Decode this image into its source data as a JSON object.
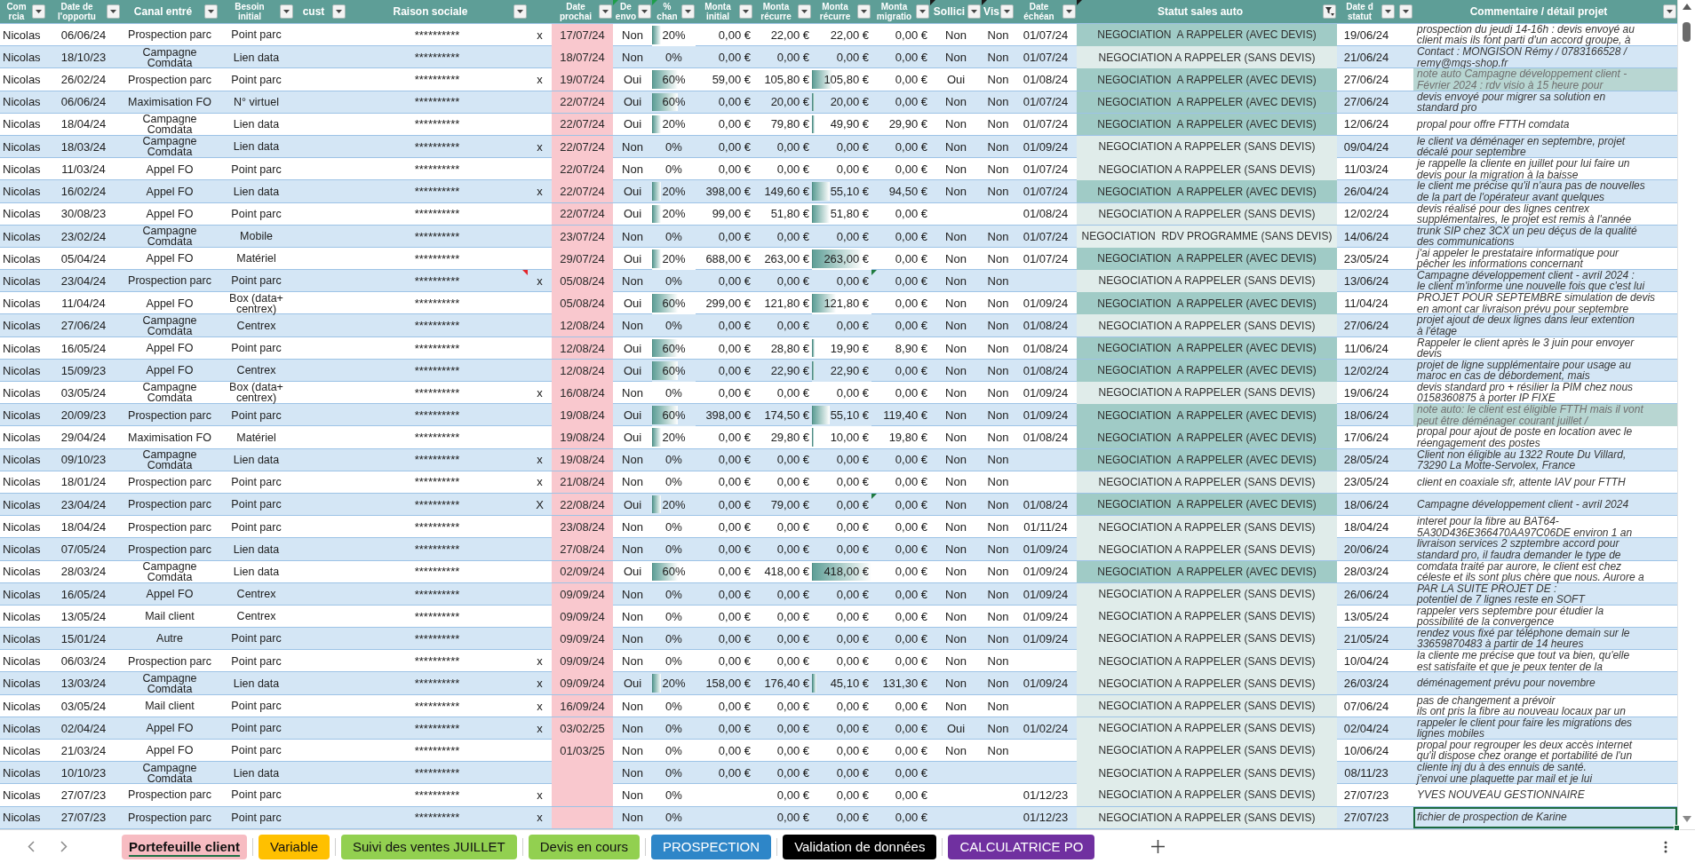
{
  "columns": [
    {
      "label": "Com\nrcia",
      "filter_active": false
    },
    {
      "label": "Date de\nl'opportu",
      "filter_active": false
    },
    {
      "label": "Canal entré",
      "filter_active": false
    },
    {
      "label": "Besoin\ninitial",
      "filter_active": false
    },
    {
      "label": "cust",
      "filter_active": false
    },
    {
      "label": "Raison sociale",
      "filter_active": false
    },
    {},
    {
      "label": "Date\nprochai",
      "filter_active": false
    },
    {
      "label": "De\nenvo",
      "filter_active": false,
      "corner_mark": {
        "color": "#1e9e4a",
        "kind": "error"
      }
    },
    {
      "label": "%\nchan",
      "filter_active": false,
      "corner_mark": {
        "color": "#1e9e4a",
        "kind": "error"
      }
    },
    {
      "label": "Monta\ninitial",
      "filter_active": false
    },
    {
      "label": "Monta\nrécurre",
      "filter_active": false
    },
    {
      "label": "Monta\nrécurre",
      "filter_active": false
    },
    {
      "label": "Monta\nmigratio",
      "filter_active": false
    },
    {
      "label": "Sollici",
      "filter_active": false,
      "corner_mark": {
        "color": "#1a1a1a",
        "kind": "error"
      }
    },
    {
      "label": "Vis",
      "filter_active": false,
      "corner_mark": {
        "color": "#1a1a1a",
        "kind": "error"
      }
    },
    {
      "label": "Date\néchéan",
      "filter_active": false
    },
    {
      "label": "Statut sales auto",
      "filter_active": true,
      "corner_mark": {
        "color": "#1a1a1a",
        "kind": "error"
      }
    },
    {
      "label": "Date d\nstatut",
      "filter_active": false
    },
    {
      "filter_active": false
    },
    {
      "label": "Commentaire / détail projet",
      "filter_active": false
    }
  ],
  "rows": [
    {
      "commercial": "Nicolas",
      "date_opportunite": "06/06/24",
      "canal": "Prospection parc",
      "besoin": "Point parc",
      "raison_sociale": "**********",
      "column_7": "x",
      "date_prochain": "17/07/24",
      "devis_envoye": "Non",
      "chance": {
        "text": "20%",
        "level": 0.2
      },
      "montant_initial": "0,00 €",
      "montant_recurrent": "22,00 €",
      "montant_recurrent_2": "22,00 €",
      "montant_migration": "0,00 €",
      "sollicit": "Non",
      "visi": "Non",
      "date_echeance": "01/07/24",
      "statut": {
        "text": "NEGOCIATION  A RAPPELER (AVEC DEVIS)",
        "color": "#a0cbc6"
      },
      "date_statut": "19/06/24",
      "commentaire": {
        "text": "prospection du jeudi 14-16h : devis envoyé au\nclient mais ils font parti d'un accord groupe, à",
        "highlighted": false,
        "selected": false
      }
    },
    {
      "commercial": "Nicolas",
      "date_opportunite": "18/10/23",
      "canal": "Campagne Comdata",
      "besoin": "Lien data",
      "raison_sociale": "**********",
      "date_prochain": "18/07/24",
      "devis_envoye": "Non",
      "chance": "0%",
      "montant_initial": "0,00 €",
      "montant_recurrent": "0,00 €",
      "montant_recurrent_2": "0,00 €",
      "montant_migration": "0,00 €",
      "sollicit": "Non",
      "visi": "Non",
      "date_echeance": "01/07/24",
      "statut": {
        "text": "NEGOCIATION A RAPPELER (SANS DEVIS)",
        "color": "#e0ecea"
      },
      "date_statut": "21/06/24",
      "commentaire": {
        "text": "Contact : MONGISON Rémy / 0783166528 /\nremy@mgs-shop.fr",
        "highlighted": false,
        "selected": false
      }
    },
    {
      "commercial": "Nicolas",
      "date_opportunite": "26/02/24",
      "canal": "Prospection parc",
      "besoin": "Point parc",
      "raison_sociale": "**********",
      "column_7": "x",
      "date_prochain": "19/07/24",
      "devis_envoye": "Oui",
      "chance": {
        "text": "60%",
        "level": 0.6
      },
      "montant_initial": "59,00 €",
      "montant_recurrent": "105,80 €",
      "montant_recurrent_2": {
        "text": "105,80 €",
        "level": 0.35
      },
      "montant_migration": "0,00 €",
      "sollicit": "Oui",
      "visi": "Non",
      "date_echeance": "01/08/24",
      "statut": {
        "text": "NEGOCIATION  A RAPPELER (AVEC DEVIS)",
        "color": "#a0cbc6"
      },
      "date_statut": "27/06/24",
      "commentaire": {
        "text": "note auto Campagne développement client -\nFévrier 2024 : rdv visio à 15 heure pour",
        "highlighted": true,
        "selected": false
      }
    },
    {
      "commercial": "Nicolas",
      "date_opportunite": "06/06/24",
      "canal": "Maximisation FO",
      "besoin": "N° virtuel",
      "raison_sociale": "**********",
      "date_prochain": "22/07/24",
      "devis_envoye": "Oui",
      "chance": {
        "text": "60%",
        "level": 0.6
      },
      "montant_initial": "0,00 €",
      "montant_recurrent": "20,00 €",
      "montant_recurrent_2": {
        "text": "20,00 €",
        "level": 0.05
      },
      "montant_migration": "0,00 €",
      "sollicit": "Non",
      "visi": "Non",
      "date_echeance": "01/07/24",
      "statut": {
        "text": "NEGOCIATION  A RAPPELER (AVEC DEVIS)",
        "color": "#a0cbc6"
      },
      "date_statut": "27/06/24",
      "commentaire": {
        "text": "devis envoyé pour migrer sa solution en\nstandard pro",
        "highlighted": false,
        "selected": false
      }
    },
    {
      "commercial": "Nicolas",
      "date_opportunite": "18/04/24",
      "canal": "Campagne Comdata",
      "besoin": "Lien data",
      "raison_sociale": "**********",
      "date_prochain": "22/07/24",
      "devis_envoye": "Oui",
      "chance": {
        "text": "20%",
        "level": 0.2
      },
      "montant_initial": "0,00 €",
      "montant_recurrent": "79,80 €",
      "montant_recurrent_2": {
        "text": "49,90 €",
        "level": 0.05
      },
      "montant_migration": "29,90 €",
      "sollicit": "Non",
      "visi": "Non",
      "date_echeance": "01/07/24",
      "statut": {
        "text": "NEGOCIATION  A RAPPELER (AVEC DEVIS)",
        "color": "#a0cbc6"
      },
      "date_statut": "12/06/24",
      "commentaire": {
        "text": "propal pour offre FTTH comdata",
        "highlighted": false,
        "selected": false
      }
    },
    {
      "commercial": "Nicolas",
      "date_opportunite": "18/03/24",
      "canal": "Campagne Comdata",
      "besoin": "Lien data",
      "raison_sociale": "**********",
      "column_7": "x",
      "date_prochain": "22/07/24",
      "devis_envoye": "Non",
      "chance": "0%",
      "montant_initial": "0,00 €",
      "montant_recurrent": "0,00 €",
      "montant_recurrent_2": "0,00 €",
      "montant_migration": "0,00 €",
      "sollicit": "Non",
      "visi": "Non",
      "date_echeance": "01/09/24",
      "statut": {
        "text": "NEGOCIATION A RAPPELER (SANS DEVIS)",
        "color": "#e0ecea"
      },
      "date_statut": "09/04/24",
      "commentaire": {
        "text": "le client va déménager en septembre, projet\ndécalé pour septembre",
        "highlighted": false,
        "selected": false
      }
    },
    {
      "commercial": "Nicolas",
      "date_opportunite": "11/03/24",
      "canal": "Appel FO",
      "besoin": "Point parc",
      "raison_sociale": "**********",
      "date_prochain": "22/07/24",
      "devis_envoye": "Non",
      "chance": "0%",
      "montant_initial": "0,00 €",
      "montant_recurrent": "0,00 €",
      "montant_recurrent_2": "0,00 €",
      "montant_migration": "0,00 €",
      "sollicit": "Non",
      "visi": "Non",
      "date_echeance": "01/07/24",
      "statut": {
        "text": "NEGOCIATION A RAPPELER (SANS DEVIS)",
        "color": "#e0ecea"
      },
      "date_statut": "11/03/24",
      "commentaire": {
        "text": "je rappelle la cliente en juillet pour lui faire un\ndevis pour la migration à la baisse",
        "highlighted": false,
        "selected": false
      }
    },
    {
      "commercial": "Nicolas",
      "date_opportunite": "16/02/24",
      "canal": "Appel FO",
      "besoin": "Lien data",
      "raison_sociale": "**********",
      "column_7": "x",
      "date_prochain": "22/07/24",
      "devis_envoye": "Oui",
      "chance": {
        "text": "20%",
        "level": 0.2
      },
      "montant_initial": "398,00 €",
      "montant_recurrent": "149,60 €",
      "montant_recurrent_2": {
        "text": "55,10 €",
        "level": 0.3
      },
      "montant_migration": "94,50 €",
      "sollicit": "Non",
      "visi": "Non",
      "date_echeance": "01/07/24",
      "statut": {
        "text": "NEGOCIATION  A RAPPELER (AVEC DEVIS)",
        "color": "#a0cbc6"
      },
      "date_statut": "26/04/24",
      "commentaire": {
        "text": "le client me précise qu'il n'aura pas de nouvelles\nde la part de l'opérateur avant quelques",
        "highlighted": false,
        "selected": false
      }
    },
    {
      "commercial": "Nicolas",
      "date_opportunite": "30/08/23",
      "canal": "Appel FO",
      "besoin": "Point parc",
      "raison_sociale": "**********",
      "date_prochain": "22/07/24",
      "devis_envoye": "Oui",
      "chance": {
        "text": "20%",
        "level": 0.2
      },
      "montant_initial": "99,00 €",
      "montant_recurrent": "51,80 €",
      "montant_recurrent_2": {
        "text": "51,80 €",
        "level": 0.3
      },
      "montant_migration": "0,00 €",
      "date_echeance": "01/08/24",
      "statut": {
        "text": "NEGOCIATION A RAPPELER (SANS DEVIS)",
        "color": "#e0ecea"
      },
      "date_statut": "12/02/24",
      "commentaire": {
        "text": "devis réalisé pour des lignes centrex\nsupplémentaires, le projet est remis à l'année",
        "highlighted": false,
        "selected": false
      }
    },
    {
      "commercial": "Nicolas",
      "date_opportunite": "23/02/24",
      "canal": "Campagne Comdata",
      "besoin": "Mobile",
      "raison_sociale": "**********",
      "date_prochain": "23/07/24",
      "devis_envoye": "Non",
      "chance": "0%",
      "montant_initial": "0,00 €",
      "montant_recurrent": "0,00 €",
      "montant_recurrent_2": "0,00 €",
      "montant_migration": "0,00 €",
      "sollicit": "Non",
      "visi": "Non",
      "date_echeance": "01/07/24",
      "statut": {
        "text": "NEGOCIATION  RDV PROGRAMME (SANS DEVIS)",
        "color": "#e4efed"
      },
      "date_statut": "14/06/24",
      "commentaire": {
        "text": "trunk SIP chez 3CX un peu déçus de la qualité\ndes communications",
        "highlighted": false,
        "selected": false
      }
    },
    {
      "commercial": "Nicolas",
      "date_opportunite": "05/04/24",
      "canal": "Appel FO",
      "besoin": "Matériel",
      "raison_sociale": "**********",
      "date_prochain": "29/07/24",
      "devis_envoye": "Oui",
      "chance": {
        "text": "20%",
        "level": 0.2
      },
      "montant_initial": "688,00 €",
      "montant_recurrent": "263,00 €",
      "montant_recurrent_2": {
        "text": "263,00 €",
        "level": 0.85
      },
      "montant_migration": "0,00 €",
      "sollicit": "Non",
      "visi": "Non",
      "date_echeance": "01/07/24",
      "statut": {
        "text": "NEGOCIATION  A RAPPELER (AVEC DEVIS)",
        "color": "#a0cbc6"
      },
      "date_statut": "23/05/24",
      "commentaire": {
        "text": "j'ai appeler le prestataire informatique pour\npêcher les informations concernant",
        "highlighted": false,
        "selected": false
      }
    },
    {
      "commercial": "Nicolas",
      "date_opportunite": "23/04/24",
      "canal": "Prospection parc",
      "besoin": "Point parc",
      "raison_sociale": {
        "text": "**********",
        "corner_mark": {
          "color": "#e3262b",
          "kind": "note"
        }
      },
      "column_7": "x",
      "date_prochain": "05/08/24",
      "devis_envoye": "Non",
      "chance": "0%",
      "montant_initial": "0,00 €",
      "montant_recurrent": "0,00 €",
      "montant_recurrent_2": "0,00 €",
      "montant_migration": {
        "text": "0,00 €",
        "corner_mark": {
          "color": "#1f7a3f",
          "kind": "error"
        }
      },
      "sollicit": "Non",
      "visi": "Non",
      "statut": {
        "text": "NEGOCIATION A RAPPELER (SANS DEVIS)",
        "color": "#e0ecea"
      },
      "date_statut": "13/06/24",
      "commentaire": {
        "text": "Campagne développement client - avril 2024 :\nle client m'informe une nouvelle fois que c'est lui",
        "highlighted": false,
        "selected": false
      }
    },
    {
      "commercial": "Nicolas",
      "date_opportunite": "11/04/24",
      "canal": "Appel FO",
      "besoin": "Box (data+ centrex)",
      "raison_sociale": "**********",
      "date_prochain": "05/08/24",
      "devis_envoye": "Oui",
      "chance": {
        "text": "60%",
        "level": 0.6
      },
      "montant_initial": "299,00 €",
      "montant_recurrent": "121,80 €",
      "montant_recurrent_2": {
        "text": "121,80 €",
        "level": 0.4
      },
      "montant_migration": "0,00 €",
      "sollicit": "Non",
      "visi": "Non",
      "date_echeance": "01/09/24",
      "statut": {
        "text": "NEGOCIATION  A RAPPELER (AVEC DEVIS)",
        "color": "#a0cbc6"
      },
      "date_statut": "11/04/24",
      "commentaire": {
        "text": "PROJET POUR SEPTEMBRE simulation de devis\nen amont car livraison prévu pour septembre",
        "highlighted": false,
        "selected": false
      }
    },
    {
      "commercial": "Nicolas",
      "date_opportunite": "27/06/24",
      "canal": "Campagne Comdata",
      "besoin": "Centrex",
      "raison_sociale": "**********",
      "date_prochain": "12/08/24",
      "devis_envoye": "Non",
      "chance": "0%",
      "montant_initial": "0,00 €",
      "montant_recurrent": "0,00 €",
      "montant_recurrent_2": "0,00 €",
      "montant_migration": "0,00 €",
      "sollicit": "Non",
      "visi": "Non",
      "date_echeance": "01/08/24",
      "statut": {
        "text": "NEGOCIATION A RAPPELER (SANS DEVIS)",
        "color": "#e0ecea"
      },
      "date_statut": "27/06/24",
      "commentaire": {
        "text": "projet ajout de deux lignes dans leur extention\nà l'étage",
        "highlighted": false,
        "selected": false
      }
    },
    {
      "commercial": "Nicolas",
      "date_opportunite": "16/05/24",
      "canal": "Appel FO",
      "besoin": "Point parc",
      "raison_sociale": "**********",
      "date_prochain": "12/08/24",
      "devis_envoye": "Oui",
      "chance": {
        "text": "60%",
        "level": 0.6
      },
      "montant_initial": "0,00 €",
      "montant_recurrent": "28,80 €",
      "montant_recurrent_2": {
        "text": "19,90 €",
        "level": 0.05
      },
      "montant_migration": "8,90 €",
      "sollicit": "Non",
      "visi": "Non",
      "date_echeance": "01/08/24",
      "statut": {
        "text": "NEGOCIATION  A RAPPELER (AVEC DEVIS)",
        "color": "#a0cbc6"
      },
      "date_statut": "11/06/24",
      "commentaire": {
        "text": "Rappeler le client après le 3 juin pour envoyer\ndevis",
        "highlighted": false,
        "selected": false
      }
    },
    {
      "commercial": "Nicolas",
      "date_opportunite": "15/09/23",
      "canal": "Appel FO",
      "besoin": "Centrex",
      "raison_sociale": "**********",
      "date_prochain": "12/08/24",
      "devis_envoye": "Oui",
      "chance": {
        "text": "60%",
        "level": 0.6
      },
      "montant_initial": "0,00 €",
      "montant_recurrent": "22,90 €",
      "montant_recurrent_2": {
        "text": "22,90 €",
        "level": 0.05
      },
      "montant_migration": "0,00 €",
      "sollicit": "Non",
      "visi": "Non",
      "date_echeance": "01/08/24",
      "statut": {
        "text": "NEGOCIATION  A RAPPELER (AVEC DEVIS)",
        "color": "#a0cbc6"
      },
      "date_statut": "12/02/24",
      "commentaire": {
        "text": "projet de ligne supplémentaire pour usage au\nmaroc en cas de débordement, mais",
        "highlighted": false,
        "selected": false
      }
    },
    {
      "commercial": "Nicolas",
      "date_opportunite": "03/05/24",
      "canal": "Campagne Comdata",
      "besoin": "Box (data+ centrex)",
      "raison_sociale": "**********",
      "column_7": "x",
      "date_prochain": "16/08/24",
      "devis_envoye": "Non",
      "chance": "0%",
      "montant_initial": "0,00 €",
      "montant_recurrent": "0,00 €",
      "montant_recurrent_2": "0,00 €",
      "montant_migration": "0,00 €",
      "sollicit": "Non",
      "visi": "Non",
      "date_echeance": "01/09/24",
      "statut": {
        "text": "NEGOCIATION A RAPPELER (SANS DEVIS)",
        "color": "#e0ecea"
      },
      "date_statut": "19/06/24",
      "commentaire": {
        "text": "devis standard pro + résilier la PIM chez nous\n0158360875 à porter IP FIXE",
        "highlighted": false,
        "selected": false
      }
    },
    {
      "commercial": "Nicolas",
      "date_opportunite": "20/09/23",
      "canal": "Prospection parc",
      "besoin": "Point parc",
      "raison_sociale": "**********",
      "date_prochain": "19/08/24",
      "devis_envoye": "Oui",
      "chance": {
        "text": "60%",
        "level": 0.6
      },
      "montant_initial": "398,00 €",
      "montant_recurrent": "174,50 €",
      "montant_recurrent_2": {
        "text": "55,10 €",
        "level": 0.3
      },
      "montant_migration": "119,40 €",
      "sollicit": "Non",
      "visi": "Non",
      "date_echeance": "01/09/24",
      "statut": {
        "text": "NEGOCIATION  A RAPPELER (AVEC DEVIS)",
        "color": "#a0cbc6"
      },
      "date_statut": "18/06/24",
      "commentaire": {
        "text": "note auto: le client est éligible FTTH mais il vont\npeut être déménager courant juillet /",
        "highlighted": true,
        "selected": false
      }
    },
    {
      "commercial": "Nicolas",
      "date_opportunite": "29/04/24",
      "canal": "Maximisation FO",
      "besoin": "Matériel",
      "raison_sociale": "**********",
      "date_prochain": "19/08/24",
      "devis_envoye": "Oui",
      "chance": {
        "text": "20%",
        "level": 0.2
      },
      "montant_initial": "0,00 €",
      "montant_recurrent": "29,80 €",
      "montant_recurrent_2": {
        "text": "10,00 €",
        "level": 0.03
      },
      "montant_migration": "19,80 €",
      "sollicit": "Non",
      "visi": "Non",
      "date_echeance": "01/08/24",
      "statut": {
        "text": "NEGOCIATION  A RAPPELER (AVEC DEVIS)",
        "color": "#a0cbc6"
      },
      "date_statut": "17/06/24",
      "commentaire": {
        "text": "propal pour ajout de poste en location avec le\nréengagement des postes",
        "highlighted": false,
        "selected": false
      }
    },
    {
      "commercial": "Nicolas",
      "date_opportunite": "09/10/23",
      "canal": "Campagne Comdata",
      "besoin": "Lien data",
      "raison_sociale": "**********",
      "column_7": "x",
      "date_prochain": "19/08/24",
      "devis_envoye": "Non",
      "chance": "0%",
      "montant_initial": "0,00 €",
      "montant_recurrent": "0,00 €",
      "montant_recurrent_2": "0,00 €",
      "montant_migration": "0,00 €",
      "sollicit": "Non",
      "visi": "Non",
      "statut": {
        "text": "NEGOCIATION  A RAPPELER (AVEC DEVIS)",
        "color": "#a0cbc6"
      },
      "date_statut": "28/05/24",
      "commentaire": {
        "text": "Client non éligible au 1322 Route Du Villard,\n73290 La Motte-Servolex, France",
        "highlighted": false,
        "selected": false
      }
    },
    {
      "commercial": "Nicolas",
      "date_opportunite": "18/01/24",
      "canal": "Prospection parc",
      "besoin": "Point parc",
      "raison_sociale": "**********",
      "column_7": "x",
      "date_prochain": "21/08/24",
      "devis_envoye": "Non",
      "chance": "0%",
      "montant_initial": "0,00 €",
      "montant_recurrent": "0,00 €",
      "montant_recurrent_2": "0,00 €",
      "montant_migration": "0,00 €",
      "sollicit": "Non",
      "visi": "Non",
      "statut": {
        "text": "NEGOCIATION A RAPPELER (SANS DEVIS)",
        "color": "#e0ecea"
      },
      "date_statut": "23/05/24",
      "commentaire": {
        "text": "client en coaxiale sfr, attente IAV pour FTTH",
        "highlighted": false,
        "selected": false
      }
    },
    {
      "commercial": "Nicolas",
      "date_opportunite": "23/04/24",
      "canal": "Prospection parc",
      "besoin": "Point parc",
      "raison_sociale": "**********",
      "column_7": "X",
      "date_prochain": "22/08/24",
      "devis_envoye": "Oui",
      "chance": {
        "text": "20%",
        "level": 0.2
      },
      "montant_initial": "0,00 €",
      "montant_recurrent": "79,00 €",
      "montant_recurrent_2": "0,00 €",
      "montant_migration": {
        "text": "0,00 €",
        "corner_mark": {
          "color": "#1f7a3f",
          "kind": "error"
        }
      },
      "sollicit": "Non",
      "visi": "Non",
      "date_echeance": "01/08/24",
      "statut": {
        "text": "NEGOCIATION  A RAPPELER (AVEC DEVIS)",
        "color": "#a0cbc6"
      },
      "date_statut": "18/06/24",
      "commentaire": {
        "text": "Campagne développement client - avril 2024",
        "highlighted": false,
        "selected": false
      }
    },
    {
      "commercial": "Nicolas",
      "date_opportunite": "18/04/24",
      "canal": "Prospection parc",
      "besoin": "Point parc",
      "raison_sociale": "**********",
      "date_prochain": "23/08/24",
      "devis_envoye": "Non",
      "chance": "0%",
      "montant_initial": "0,00 €",
      "montant_recurrent": "0,00 €",
      "montant_recurrent_2": "0,00 €",
      "montant_migration": "0,00 €",
      "sollicit": "Non",
      "visi": "Non",
      "date_echeance": "01/11/24",
      "statut": {
        "text": "NEGOCIATION A RAPPELER (SANS DEVIS)",
        "color": "#e0ecea"
      },
      "date_statut": "18/04/24",
      "commentaire": {
        "text": "interet pour la fibre au BAT64-\n5A30D436E366470AA97C06DE environ 1 an",
        "highlighted": false,
        "selected": false
      }
    },
    {
      "commercial": "Nicolas",
      "date_opportunite": "07/05/24",
      "canal": "Prospection parc",
      "besoin": "Lien data",
      "raison_sociale": "**********",
      "date_prochain": "27/08/24",
      "devis_envoye": "Non",
      "chance": "0%",
      "montant_initial": "0,00 €",
      "montant_recurrent": "0,00 €",
      "montant_recurrent_2": "0,00 €",
      "montant_migration": "0,00 €",
      "sollicit": "Non",
      "visi": "Non",
      "date_echeance": "01/09/24",
      "statut": {
        "text": "NEGOCIATION A RAPPELER (SANS DEVIS)",
        "color": "#e0ecea"
      },
      "date_statut": "20/06/24",
      "commentaire": {
        "text": "livraison services 2 szptembre accord pour\nstandard pro, il faudra demander le type de",
        "highlighted": false,
        "selected": false
      }
    },
    {
      "commercial": "Nicolas",
      "date_opportunite": "28/03/24",
      "canal": "Campagne Comdata",
      "besoin": "Lien data",
      "raison_sociale": "**********",
      "date_prochain": "02/09/24",
      "devis_envoye": "Oui",
      "chance": {
        "text": "60%",
        "level": 0.6
      },
      "montant_initial": "0,00 €",
      "montant_recurrent": "418,00 €",
      "montant_recurrent_2": {
        "text": "418,00 €",
        "level": 1
      },
      "montant_migration": "0,00 €",
      "sollicit": "Non",
      "visi": "Non",
      "date_echeance": "01/09/24",
      "statut": {
        "text": "NEGOCIATION  A RAPPELER (AVEC DEVIS)",
        "color": "#a0cbc6"
      },
      "date_statut": "28/03/24",
      "commentaire": {
        "text": "comdata traité par aurore, le client est chez\ncéleste et ils sont plus chère que nous. Aurore a",
        "highlighted": false,
        "selected": false
      }
    },
    {
      "commercial": "Nicolas",
      "date_opportunite": "16/05/24",
      "canal": "Appel FO",
      "besoin": "Centrex",
      "raison_sociale": "**********",
      "date_prochain": "09/09/24",
      "devis_envoye": "Non",
      "chance": "0%",
      "montant_initial": "0,00 €",
      "montant_recurrent": "0,00 €",
      "montant_recurrent_2": "0,00 €",
      "montant_migration": "0,00 €",
      "sollicit": "Non",
      "visi": "Non",
      "date_echeance": "01/09/24",
      "statut": {
        "text": "NEGOCIATION A RAPPELER (SANS DEVIS)",
        "color": "#e0ecea"
      },
      "date_statut": "26/06/24",
      "commentaire": {
        "text": "PAR LA SUITE PROJET DE :\npotentiel de 7 lignes reste en SOFT",
        "highlighted": false,
        "selected": false
      }
    },
    {
      "commercial": "Nicolas",
      "date_opportunite": "13/05/24",
      "canal": "Mail client",
      "besoin": "Centrex",
      "raison_sociale": "**********",
      "date_prochain": "09/09/24",
      "devis_envoye": "Non",
      "chance": "0%",
      "montant_initial": "0,00 €",
      "montant_recurrent": "0,00 €",
      "montant_recurrent_2": "0,00 €",
      "montant_migration": "0,00 €",
      "sollicit": "Non",
      "visi": "Non",
      "date_echeance": "01/09/24",
      "statut": {
        "text": "NEGOCIATION A RAPPELER (SANS DEVIS)",
        "color": "#e0ecea"
      },
      "date_statut": "13/05/24",
      "commentaire": {
        "text": "rappeler vers septembre pour étudier la\npossibilité de la convergence",
        "highlighted": false,
        "selected": false
      }
    },
    {
      "commercial": "Nicolas",
      "date_opportunite": "15/01/24",
      "canal": "Autre",
      "besoin": "Point parc",
      "raison_sociale": "**********",
      "date_prochain": "09/09/24",
      "devis_envoye": "Non",
      "chance": "0%",
      "montant_initial": "0,00 €",
      "montant_recurrent": "0,00 €",
      "montant_recurrent_2": "0,00 €",
      "montant_migration": "0,00 €",
      "sollicit": "Non",
      "visi": "Non",
      "date_echeance": "01/09/24",
      "statut": {
        "text": "NEGOCIATION A RAPPELER (SANS DEVIS)",
        "color": "#e0ecea"
      },
      "date_statut": "21/05/24",
      "commentaire": {
        "text": "rendez vous fixé par téléphone demain sur le\n33659870483 à partir de 14 heures",
        "highlighted": false,
        "selected": false
      }
    },
    {
      "commercial": "Nicolas",
      "date_opportunite": "06/03/24",
      "canal": "Prospection parc",
      "besoin": "Point parc",
      "raison_sociale": "**********",
      "column_7": "x",
      "date_prochain": "09/09/24",
      "devis_envoye": "Non",
      "chance": "0%",
      "montant_initial": "0,00 €",
      "montant_recurrent": "0,00 €",
      "montant_recurrent_2": "0,00 €",
      "montant_migration": "0,00 €",
      "sollicit": "Non",
      "visi": "Non",
      "statut": {
        "text": "NEGOCIATION A RAPPELER (SANS DEVIS)",
        "color": "#e0ecea"
      },
      "date_statut": "10/04/24",
      "commentaire": {
        "text": "la cliente me précise que tout va bien, qu'elle\nest satisfaite et que je peux tenter de la",
        "highlighted": false,
        "selected": false
      }
    },
    {
      "commercial": "Nicolas",
      "date_opportunite": "13/03/24",
      "canal": "Campagne Comdata",
      "besoin": "Lien data",
      "raison_sociale": "**********",
      "column_7": "x",
      "date_prochain": "09/09/24",
      "devis_envoye": "Oui",
      "chance": {
        "text": "20%",
        "level": 0.2
      },
      "montant_initial": "158,00 €",
      "montant_recurrent": "176,40 €",
      "montant_recurrent_2": {
        "text": "45,10 €",
        "level": 0.08
      },
      "montant_migration": "131,30 €",
      "sollicit": "Non",
      "visi": "Non",
      "date_echeance": "01/09/24",
      "statut": {
        "text": "NEGOCIATION A RAPPELER (SANS DEVIS)",
        "color": "#e0ecea"
      },
      "date_statut": "26/03/24",
      "commentaire": {
        "text": "déménagement prévu pour novembre",
        "highlighted": false,
        "selected": false
      }
    },
    {
      "commercial": "Nicolas",
      "date_opportunite": "03/05/24",
      "canal": "Mail client",
      "besoin": "Point parc",
      "raison_sociale": "**********",
      "column_7": "x",
      "date_prochain": "16/09/24",
      "devis_envoye": "Non",
      "chance": "0%",
      "montant_initial": "0,00 €",
      "montant_recurrent": "0,00 €",
      "montant_recurrent_2": "0,00 €",
      "montant_migration": "0,00 €",
      "sollicit": "Non",
      "visi": "Non",
      "statut": {
        "text": "NEGOCIATION A RAPPELER (SANS DEVIS)",
        "color": "#e0ecea"
      },
      "date_statut": "07/06/24",
      "commentaire": {
        "text": "pas de changement a prévoir\nils ont pris la fibre au nouveau locaux par un",
        "highlighted": false,
        "selected": false
      }
    },
    {
      "commercial": "Nicolas",
      "date_opportunite": "02/04/24",
      "canal": "Appel FO",
      "besoin": "Point parc",
      "raison_sociale": "**********",
      "column_7": "x",
      "date_prochain": "03/02/25",
      "devis_envoye": "Non",
      "chance": "0%",
      "montant_initial": "0,00 €",
      "montant_recurrent": "0,00 €",
      "montant_recurrent_2": "0,00 €",
      "montant_migration": "0,00 €",
      "sollicit": "Oui",
      "visi": "Non",
      "date_echeance": "01/02/24",
      "statut": {
        "text": "NEGOCIATION A RAPPELER (SANS DEVIS)",
        "color": "#e0ecea"
      },
      "date_statut": "02/04/24",
      "commentaire": {
        "text": "rappeler le client pour faire les migrations des\nlignes mobiles",
        "highlighted": false,
        "selected": false
      }
    },
    {
      "commercial": "Nicolas",
      "date_opportunite": "21/03/24",
      "canal": "Appel FO",
      "besoin": "Point parc",
      "raison_sociale": "**********",
      "date_prochain": "01/03/25",
      "devis_envoye": "Non",
      "chance": "0%",
      "montant_initial": "0,00 €",
      "montant_recurrent": "0,00 €",
      "montant_recurrent_2": "0,00 €",
      "montant_migration": "0,00 €",
      "sollicit": "Non",
      "visi": "Non",
      "statut": {
        "text": "NEGOCIATION A RAPPELER (SANS DEVIS)",
        "color": "#e0ecea"
      },
      "date_statut": "10/06/24",
      "commentaire": {
        "text": "propal pour regrouper les deux accès internet\nqu'il dispose chez orange et portabilité de l'un",
        "highlighted": false,
        "selected": false
      }
    },
    {
      "commercial": "Nicolas",
      "date_opportunite": "10/10/23",
      "canal": "Campagne Comdata",
      "besoin": "Lien data",
      "raison_sociale": "**********",
      "devis_envoye": "Non",
      "chance": "0%",
      "montant_initial": "0,00 €",
      "montant_recurrent": "0,00 €",
      "montant_recurrent_2": "0,00 €",
      "montant_migration": "0,00 €",
      "statut": {
        "text": "NEGOCIATION A RAPPELER (SANS DEVIS)",
        "color": "#e0ecea"
      },
      "date_statut": "08/11/23",
      "commentaire": {
        "text": "cliente inj du à des ennuis de santé.\nj'envoi une plaquette par mail et je lui",
        "highlighted": false,
        "selected": false
      }
    },
    {
      "commercial": "Nicolas",
      "date_opportunite": "27/07/23",
      "canal": "Prospection parc",
      "besoin": "Point parc",
      "raison_sociale": "**********",
      "column_7": "x",
      "devis_envoye": "Non",
      "chance": "0%",
      "montant_recurrent": "0,00 €",
      "montant_recurrent_2": "0,00 €",
      "montant_migration": "0,00 €",
      "date_echeance": "01/12/23",
      "statut": {
        "text": "NEGOCIATION A RAPPELER (SANS DEVIS)",
        "color": "#e0ecea"
      },
      "date_statut": "27/07/23",
      "commentaire": {
        "text": "YVES NOUVEAU GESTIONNAIRE",
        "highlighted": false,
        "selected": false
      }
    },
    {
      "commercial": "Nicolas",
      "date_opportunite": "27/07/23",
      "canal": "Prospection parc",
      "besoin": "Point parc",
      "raison_sociale": "**********",
      "column_7": "x",
      "devis_envoye": "Non",
      "chance": "0%",
      "montant_recurrent": "0,00 €",
      "montant_recurrent_2": "0,00 €",
      "montant_migration": "0,00 €",
      "date_echeance": "01/12/23",
      "statut": {
        "text": "NEGOCIATION A RAPPELER (SANS DEVIS)",
        "color": "#e0ecea"
      },
      "date_statut": "27/07/23",
      "commentaire": {
        "text": "fichier de prospection de Karine",
        "highlighted": false,
        "selected": true
      }
    }
  ],
  "sheet_tabs": [
    {
      "label": "Portefeuille client",
      "color": "#f7bcc2",
      "selected": true
    },
    {
      "label": "Variable",
      "color": "#ffc000",
      "selected": false
    },
    {
      "label": "Suivi des ventes JUILLET",
      "color": "#92d050",
      "selected": false
    },
    {
      "label": "Devis en cours",
      "color": "#92d050",
      "selected": false
    },
    {
      "label": "PROSPECTION",
      "color": "#2e86c8",
      "selected": false
    },
    {
      "label": "Validation de données",
      "color": "#000000",
      "selected": false
    },
    {
      "label": "CALCULATRICE PO",
      "color": "#7030a0",
      "selected": false
    }
  ]
}
